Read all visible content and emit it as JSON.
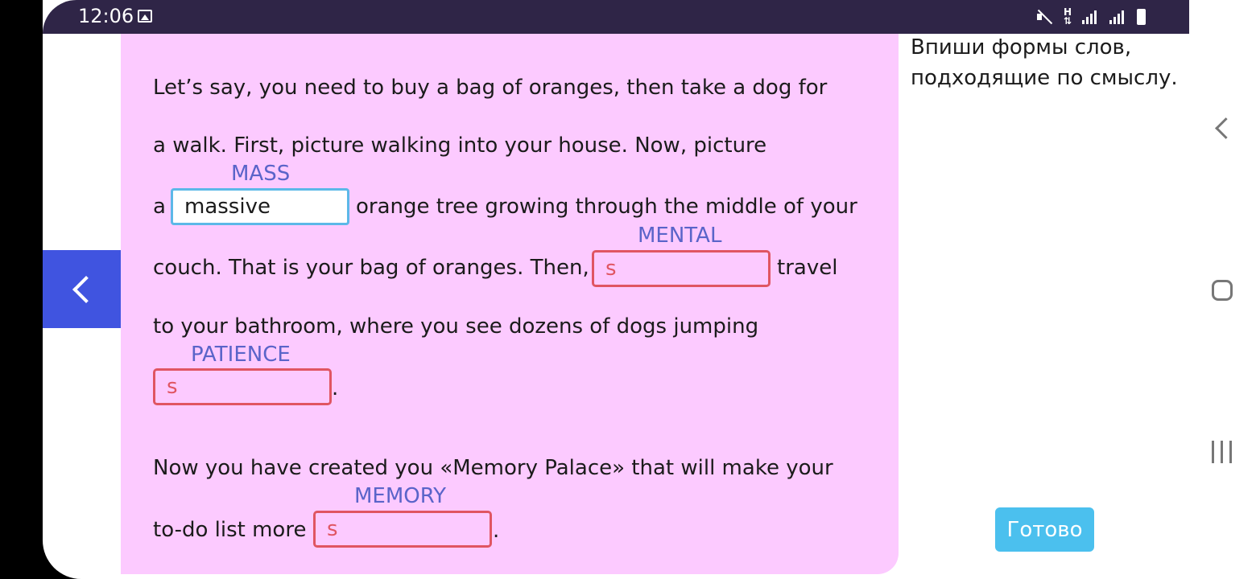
{
  "status_bar": {
    "time": "12:06",
    "icons": [
      "image-icon",
      "mute-icon",
      "mobile-data-icon",
      "signal-icon",
      "signal-icon",
      "battery-icon"
    ],
    "data_label": "H"
  },
  "exercise": {
    "lines": {
      "l1": "Let’s say, you need to buy a bag of oranges, then take a dog for",
      "l2": "a walk. First, picture walking into your house. Now, picture",
      "l3_pre": "a",
      "l3_post": "orange tree growing through the middle of your",
      "l4_pre": "couch. That is your bag of oranges. Then,",
      "l4_post": "travel",
      "l5": "to your bathroom, where you see dozens of dogs jumping",
      "l6_post": ".",
      "l7": "Now you have created you «Memory Palace» that will make your",
      "l8_pre": "to-do list more",
      "l8_post": "."
    },
    "gaps": [
      {
        "hint": "MASS",
        "value": "massive",
        "status": "correct"
      },
      {
        "hint": "MENTAL",
        "value": "s",
        "status": "incorrect"
      },
      {
        "hint": "PATIENCE",
        "value": "s",
        "status": "incorrect"
      },
      {
        "hint": "MEMORY",
        "value": "s",
        "status": "incorrect"
      }
    ]
  },
  "instruction": {
    "line1": "Впиши формы слов,",
    "line2": "подходящие по смыслу."
  },
  "buttons": {
    "done": "Готово"
  },
  "colors": {
    "panel": "#fccaff",
    "hint": "#5a64c9",
    "error": "#e05562",
    "correct_border": "#5cb8e8",
    "accent": "#4054e0",
    "done": "#4bc0ee",
    "status_bar": "#2f2547"
  }
}
